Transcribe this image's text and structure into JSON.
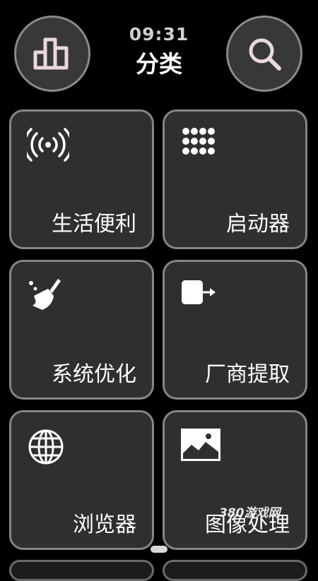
{
  "header": {
    "time": "09:31",
    "title": "分类"
  },
  "icons": {
    "stats": "bar-chart-icon",
    "search": "search-icon"
  },
  "tiles": [
    {
      "label": "生活便利",
      "icon": "signal-broadcast-icon"
    },
    {
      "label": "启动器",
      "icon": "app-grid-icon"
    },
    {
      "label": "系统优化",
      "icon": "broom-clean-icon"
    },
    {
      "label": "厂商提取",
      "icon": "export-icon"
    },
    {
      "label": "浏览器",
      "icon": "globe-icon"
    },
    {
      "label": "图像处理",
      "icon": "image-icon"
    }
  ],
  "watermark": "380游戏网",
  "colors": {
    "background": "#000000",
    "tile": "#2f2f2f",
    "border": "#858585"
  }
}
